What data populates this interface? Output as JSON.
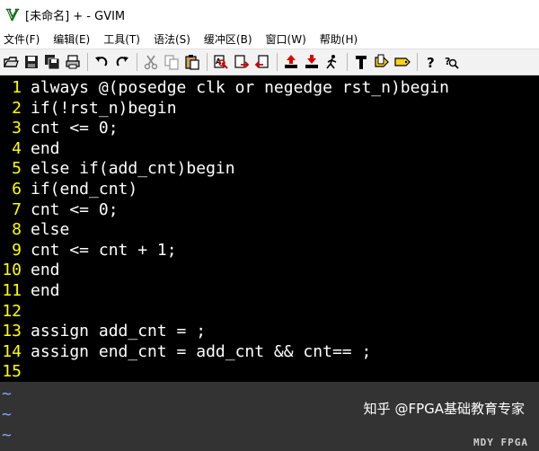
{
  "window": {
    "title": "[未命名] + - GVIM",
    "icon": "gvim-logo-icon",
    "accent_color": "#1a8a1a"
  },
  "menu": {
    "items": [
      {
        "label": "文件(F)"
      },
      {
        "label": "编辑(E)"
      },
      {
        "label": "工具(T)"
      },
      {
        "label": "语法(S)"
      },
      {
        "label": "缓冲区(B)"
      },
      {
        "label": "窗口(W)"
      },
      {
        "label": "帮助(H)"
      }
    ]
  },
  "toolbar": {
    "buttons": [
      "open-icon",
      "save-icon",
      "save-all-icon",
      "print-icon",
      "undo-icon",
      "redo-icon",
      "cut-icon",
      "copy-icon",
      "paste-icon",
      "find-replace-icon",
      "find-next-icon",
      "find-prev-icon",
      "load-session-icon",
      "save-session-icon",
      "run-script-icon",
      "make-icon",
      "run-ctags-icon",
      "tag-jump-icon",
      "help-icon",
      "find-help-icon"
    ]
  },
  "editor": {
    "lines": [
      {
        "num": "1",
        "text": "always @(posedge clk or negedge rst_n)begin"
      },
      {
        "num": "2",
        "text": "if(!rst_n)begin"
      },
      {
        "num": "3",
        "text": "cnt <= 0;"
      },
      {
        "num": "4",
        "text": "end"
      },
      {
        "num": "5",
        "text": "else if(add_cnt)begin"
      },
      {
        "num": "6",
        "text": "if(end_cnt)"
      },
      {
        "num": "7",
        "text": "cnt <= 0;"
      },
      {
        "num": "8",
        "text": "else"
      },
      {
        "num": "9",
        "text": "cnt <= cnt + 1;"
      },
      {
        "num": "10",
        "text": "end"
      },
      {
        "num": "11",
        "text": "end"
      },
      {
        "num": "12",
        "text": ""
      },
      {
        "num": "13",
        "text": "assign add_cnt = ;"
      },
      {
        "num": "14",
        "text": "assign end_cnt = add_cnt && cnt== ;"
      },
      {
        "num": "15",
        "text": ""
      }
    ],
    "tildes": [
      "~",
      "~",
      "~"
    ],
    "line_number_color": "#ffff00",
    "text_color": "#ffffff",
    "background": "#000000"
  },
  "watermark": {
    "text": "知乎 @FPGA基础教育专家",
    "text2": "MDY FPGA"
  }
}
